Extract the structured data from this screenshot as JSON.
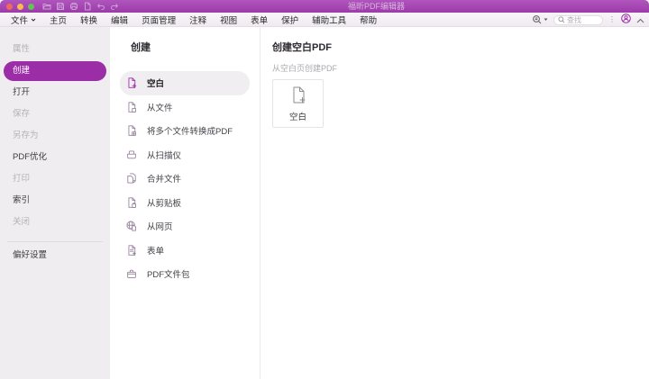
{
  "colors": {
    "titlebar_purple": "#9c3baa",
    "accent_purple": "#9b2da7",
    "menubar_bg": "#f4eff5",
    "sidebar_bg": "#efedf0",
    "selected_row_bg": "#f0eef1",
    "text": "#3e3b40",
    "disabled_text": "#b6b3b8",
    "muted_text": "#aba8ad"
  },
  "titlebar": {
    "title": "福昕PDF编辑器",
    "traffic_lights": [
      "close",
      "minimize",
      "fullscreen"
    ],
    "quick_icons": [
      "open-folder-icon",
      "save-icon",
      "print-icon",
      "new-document-icon",
      "undo-icon",
      "redo-icon"
    ]
  },
  "menubar": {
    "items": [
      "文件",
      "主页",
      "转换",
      "编辑",
      "页面管理",
      "注释",
      "视图",
      "表单",
      "保护",
      "辅助工具",
      "帮助"
    ],
    "search": {
      "placeholder": "查找"
    },
    "right_icons": [
      "find-replace-icon",
      "more-icon",
      "account-icon",
      "collapse-ribbon-icon"
    ]
  },
  "sidebar": {
    "items": [
      {
        "label": "属性",
        "state": "disabled"
      },
      {
        "label": "创建",
        "state": "selected"
      },
      {
        "label": "打开",
        "state": "normal"
      },
      {
        "label": "保存",
        "state": "disabled"
      },
      {
        "label": "另存为",
        "state": "disabled"
      },
      {
        "label": "PDF优化",
        "state": "normal"
      },
      {
        "label": "打印",
        "state": "disabled"
      },
      {
        "label": "索引",
        "state": "normal"
      },
      {
        "label": "关闭",
        "state": "disabled"
      }
    ],
    "footer_item": {
      "label": "偏好设置",
      "state": "normal"
    }
  },
  "create_panel": {
    "title": "创建",
    "items": [
      {
        "label": "空白",
        "icon": "blank-page-plus-icon",
        "selected": true
      },
      {
        "label": "从文件",
        "icon": "from-file-icon",
        "selected": false
      },
      {
        "label": "将多个文件转换成PDF",
        "icon": "multiple-files-to-pdf-icon",
        "selected": false
      },
      {
        "label": "从扫描仪",
        "icon": "from-scanner-icon",
        "selected": false
      },
      {
        "label": "合并文件",
        "icon": "combine-files-icon",
        "selected": false
      },
      {
        "label": "从剪贴板",
        "icon": "from-clipboard-icon",
        "selected": false
      },
      {
        "label": "从网页",
        "icon": "from-webpage-icon",
        "selected": false
      },
      {
        "label": "表单",
        "icon": "form-icon",
        "selected": false
      },
      {
        "label": "PDF文件包",
        "icon": "pdf-portfolio-icon",
        "selected": false
      }
    ]
  },
  "detail_panel": {
    "title": "创建空白PDF",
    "subtitle": "从空白页创建PDF",
    "card": {
      "label": "空白",
      "icon": "blank-page-plus-icon"
    }
  }
}
